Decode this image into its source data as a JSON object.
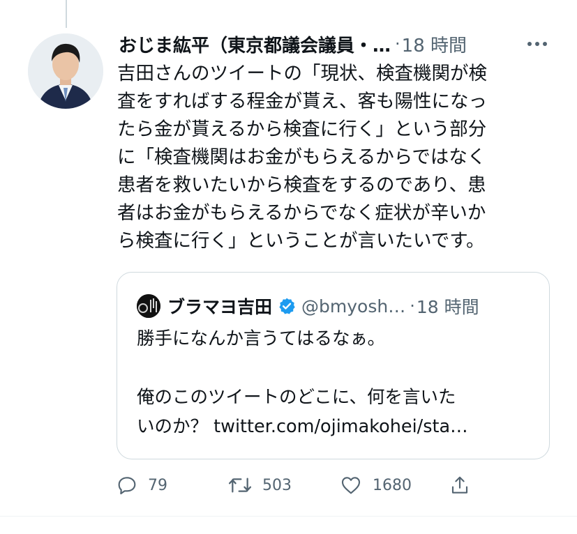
{
  "tweet": {
    "author_name": "おじま紘平（東京都議会議員・…",
    "separator": "·",
    "time": "18 時間",
    "body_lines": [
      "吉田さんのツイートの「現状、検査機関が検",
      "査をすればする程金が貰え、客も陽性になっ",
      "たら金が貰えるから検査に行く」という部分",
      "に「検査機関はお金がもらえるからではなく",
      "患者を救いたいから検査をするのであり、患",
      "者はお金がもらえるからでなく症状が辛いか",
      "ら検査に行く」ということが言いたいです。"
    ]
  },
  "quoted_tweet": {
    "author_name": "ブラマヨ吉田",
    "handle": "@bmyosh…",
    "separator": "·",
    "time": "18 時間",
    "text_line_1": "勝手になんか言うてはるなぁ。",
    "text_line_2": "俺のこのツイートのどこに、何を言いた",
    "text_line_3": "いのか？ twitter.com/ojimakohei/sta…"
  },
  "actions": {
    "reply_count": "79",
    "retweet_count": "503",
    "like_count": "1680"
  },
  "icons": {
    "more": "more-horizontal-icon",
    "reply": "reply-icon",
    "retweet": "retweet-icon",
    "like": "heart-icon",
    "share": "share-icon",
    "verified": "verified-badge-icon"
  },
  "colors": {
    "text": "#0f1419",
    "secondary": "#536471",
    "border": "#cfd9de",
    "verified": "#1d9bf0"
  }
}
